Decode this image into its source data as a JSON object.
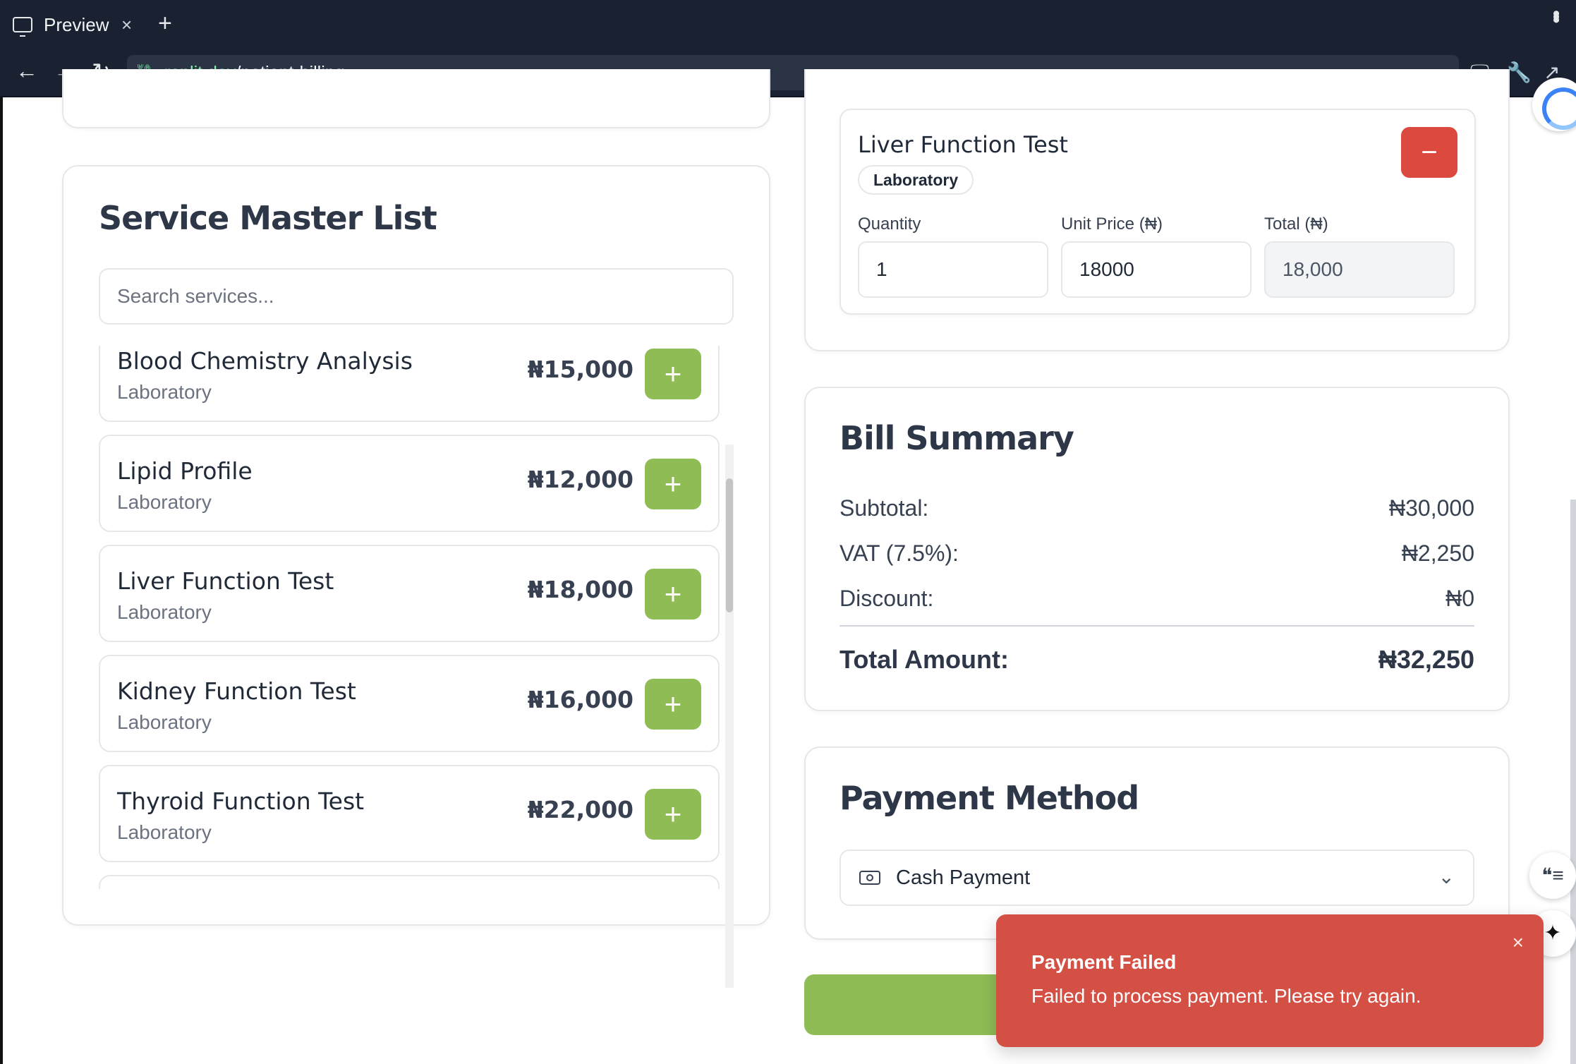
{
  "browser": {
    "tab_title": "Preview",
    "tab_close": "×",
    "new_tab": "+",
    "url_host": ".replit.dev",
    "url_path": "/patient-billing"
  },
  "service_master": {
    "title": "Service Master List",
    "search_placeholder": "Search services...",
    "items": [
      {
        "name": "Blood Chemistry Analysis",
        "category": "Laboratory",
        "price": "₦15,000"
      },
      {
        "name": "Lipid Profile",
        "category": "Laboratory",
        "price": "₦12,000"
      },
      {
        "name": "Liver Function Test",
        "category": "Laboratory",
        "price": "₦18,000"
      },
      {
        "name": "Kidney Function Test",
        "category": "Laboratory",
        "price": "₦16,000"
      },
      {
        "name": "Thyroid Function Test",
        "category": "Laboratory",
        "price": "₦22,000"
      }
    ],
    "add_symbol": "+"
  },
  "selected_item": {
    "name": "Liver Function Test",
    "category": "Laboratory",
    "remove_symbol": "−",
    "quantity_label": "Quantity",
    "quantity": "1",
    "unit_price_label": "Unit Price (₦)",
    "unit_price": "18000",
    "total_label": "Total (₦)",
    "total": "18,000"
  },
  "bill_summary": {
    "title": "Bill Summary",
    "subtotal_label": "Subtotal:",
    "subtotal": "₦30,000",
    "vat_label": "VAT (7.5%):",
    "vat": "₦2,250",
    "discount_label": "Discount:",
    "discount": "₦0",
    "total_label": "Total Amount:",
    "total": "₦32,250"
  },
  "payment": {
    "title": "Payment Method",
    "selected": "Cash Payment"
  },
  "toast": {
    "title": "Payment Failed",
    "message": "Failed to process payment. Please try again.",
    "close": "×"
  },
  "colors": {
    "accent_green": "#8fbc55",
    "danger_red": "#dc4a3f",
    "toast_red": "#d44f44",
    "chrome_dark": "#1a2231"
  }
}
